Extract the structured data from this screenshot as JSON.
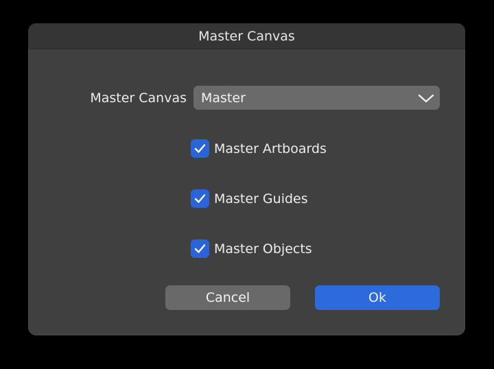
{
  "dialog": {
    "title": "Master Canvas",
    "master_canvas_label": "Master Canvas",
    "master_canvas_select": {
      "value": "Master",
      "icon": "chevron-down-icon"
    },
    "options": [
      {
        "label": "Master Artboards",
        "checked": true
      },
      {
        "label": "Master Guides",
        "checked": true
      },
      {
        "label": "Master Objects",
        "checked": true
      }
    ],
    "buttons": {
      "cancel": "Cancel",
      "ok": "Ok"
    }
  },
  "colors": {
    "background": "#000000",
    "dialog": "#404040",
    "accent": "#2d6bdc",
    "secondary_button": "#696969"
  }
}
